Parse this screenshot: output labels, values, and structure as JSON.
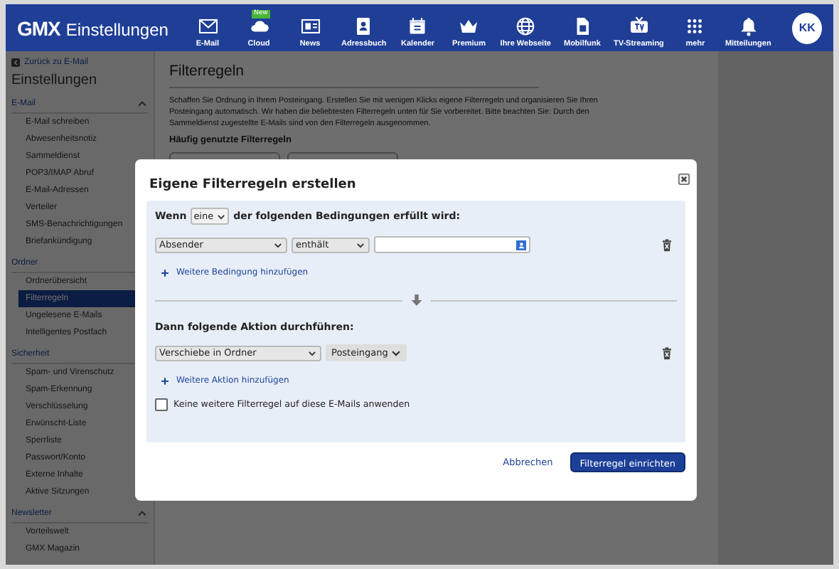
{
  "header": {
    "logo": "GMX",
    "title": "Einstellungen",
    "nav": [
      {
        "label": "E-Mail"
      },
      {
        "label": "Cloud",
        "badge": "New"
      },
      {
        "label": "News"
      },
      {
        "label": "Adressbuch"
      },
      {
        "label": "Kalender"
      },
      {
        "label": "Premium"
      },
      {
        "label": "Ihre Webseite"
      },
      {
        "label": "Mobilfunk"
      },
      {
        "label": "TV-Streaming"
      },
      {
        "label": "mehr"
      }
    ],
    "notifications": "Mitteilungen",
    "avatar": "KK"
  },
  "sidebar": {
    "back": "Zurück zu E-Mail",
    "title": "Einstellungen",
    "sections": [
      {
        "title": "E-Mail",
        "toggle": true,
        "items": [
          {
            "label": "E-Mail schreiben",
            "selected": false
          },
          {
            "label": "Abwesenheitsnotiz",
            "selected": false
          },
          {
            "label": "Sammeldienst",
            "selected": false
          },
          {
            "label": "POP3/IMAP Abruf",
            "selected": false
          },
          {
            "label": "E-Mail-Adressen",
            "selected": false
          },
          {
            "label": "Verteiler",
            "selected": false
          },
          {
            "label": "SMS-Benachrichtigungen",
            "selected": false
          },
          {
            "label": "Briefankündigung",
            "selected": false
          }
        ]
      },
      {
        "title": "Ordner",
        "toggle": false,
        "items": [
          {
            "label": "Ordnerübersicht",
            "selected": false
          },
          {
            "label": "Filterregeln",
            "selected": true
          },
          {
            "label": "Ungelesene E-Mails",
            "selected": false
          },
          {
            "label": "Intelligentes Postfach",
            "selected": false
          }
        ]
      },
      {
        "title": "Sicherheit",
        "toggle": false,
        "items": [
          {
            "label": "Spam- und Virenschutz",
            "selected": false
          },
          {
            "label": "Spam-Erkennung",
            "selected": false
          },
          {
            "label": "Verschlüsselung",
            "selected": false
          },
          {
            "label": "Erwünscht-Liste",
            "selected": false
          },
          {
            "label": "Sperrliste",
            "selected": false
          },
          {
            "label": "Passwort/Konto",
            "selected": false
          },
          {
            "label": "Externe Inhalte",
            "selected": false
          },
          {
            "label": "Aktive Sitzungen",
            "selected": false
          }
        ]
      },
      {
        "title": "Newsletter",
        "toggle": true,
        "items": [
          {
            "label": "Vorteilswelt",
            "selected": false
          },
          {
            "label": "GMX Magazin",
            "selected": false
          }
        ]
      }
    ]
  },
  "content": {
    "title": "Filterregeln",
    "intro": "Schaffen Sie Ordnung in Ihrem Posteingang. Erstellen Sie mit wenigen Klicks eigene Filterregeln und organisieren Sie Ihren Posteingang automatisch. Wir haben die beliebtesten Filterregeln unten für Sie vorbereitet. Bitte beachten Sie: Durch den Sammeldienst zugestellte E-Mails sind von den Filterregeln ausgenommen.",
    "subheading": "Häufig genutzte Filterregeln"
  },
  "dialog": {
    "title": "Eigene Filterregeln erstellen",
    "condition_intro": {
      "before": "Wenn",
      "match": "eine",
      "after": "der folgenden Bedingungen erfüllt wird:"
    },
    "condition": {
      "field": "Absender",
      "operator": "enthält"
    },
    "add_condition": "Weitere Bedingung hinzufügen",
    "action_heading": "Dann folgende Aktion durchführen:",
    "action": {
      "type": "Verschiebe in Ordner",
      "folder": "Posteingang"
    },
    "add_action": "Weitere Aktion hinzufügen",
    "stop_rule": {
      "label": "Keine weitere Filterregel auf diese E-Mails anwenden",
      "checked": false
    },
    "cancel": "Abbrechen",
    "submit": "Filterregel einrichten"
  }
}
